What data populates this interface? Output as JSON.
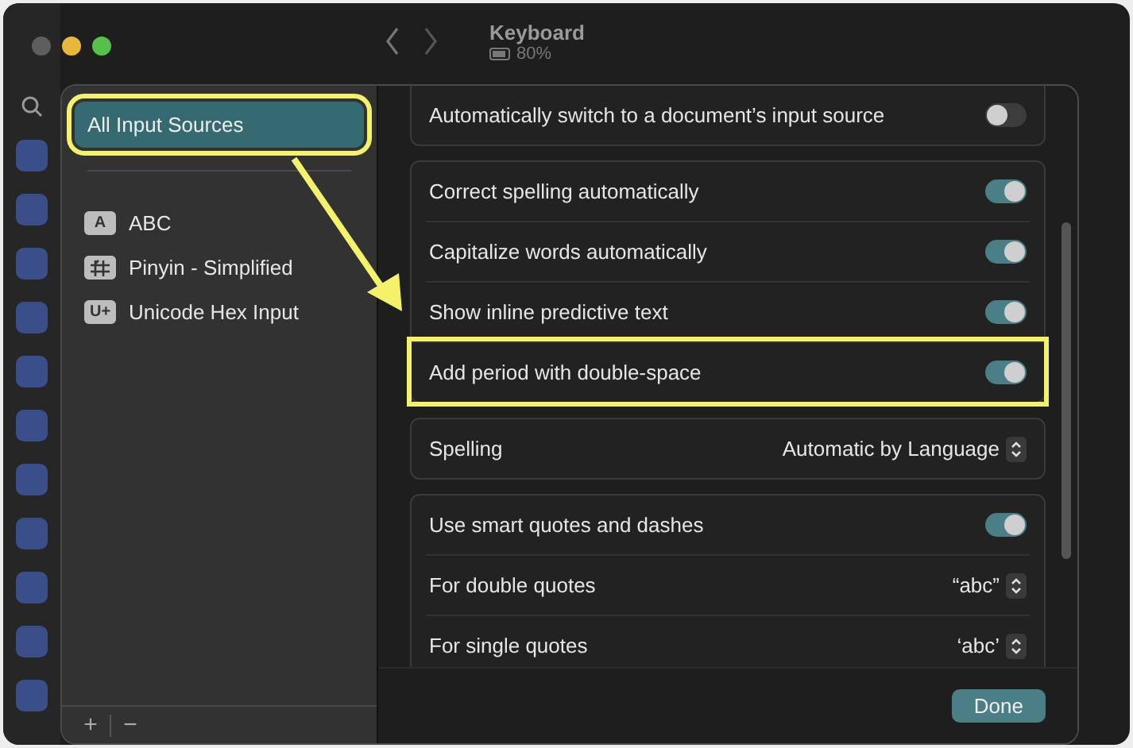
{
  "window": {
    "title": "Keyboard",
    "battery": "80%"
  },
  "sources_selected": {
    "label": "All Input Sources",
    "selected": true,
    "highlighted": true
  },
  "sources": [
    {
      "kind": "letters",
      "badge": "A",
      "label": "ABC"
    },
    {
      "kind": "glyph",
      "label": "Pinyin - Simplified"
    },
    {
      "kind": "letters",
      "badge": "U+",
      "label": "Unicode Hex Input"
    }
  ],
  "groups": [
    {
      "rows": [
        {
          "kind": "toggle",
          "label": "Automatically switch to a document’s input source",
          "on": false,
          "highlighted": false
        }
      ]
    },
    {
      "rows": [
        {
          "kind": "toggle",
          "label": "Correct spelling automatically",
          "on": true,
          "highlighted": false
        },
        {
          "kind": "toggle",
          "label": "Capitalize words automatically",
          "on": true,
          "highlighted": false
        },
        {
          "kind": "toggle",
          "label": "Show inline predictive text",
          "on": true,
          "highlighted": false
        },
        {
          "kind": "toggle",
          "label": "Add period with double-space",
          "on": true,
          "highlighted": true
        }
      ]
    },
    {
      "rows": [
        {
          "kind": "popup",
          "label": "Spelling",
          "value": "Automatic by Language",
          "highlighted": false
        }
      ]
    },
    {
      "rows": [
        {
          "kind": "toggle",
          "label": "Use smart quotes and dashes",
          "on": true,
          "highlighted": false
        },
        {
          "kind": "popup",
          "label": "For double quotes",
          "value": "“abc”",
          "highlighted": false
        },
        {
          "kind": "popup",
          "label": "For single quotes",
          "value": "‘abc’",
          "highlighted": false
        }
      ]
    }
  ],
  "list_buttons": [
    "+",
    "−"
  ],
  "done_button": "Done"
}
